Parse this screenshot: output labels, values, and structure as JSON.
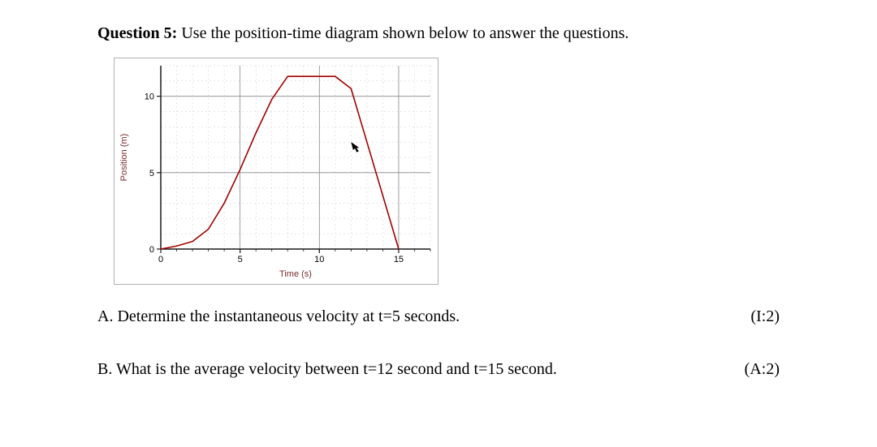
{
  "question": {
    "label": "Question 5:",
    "prompt": "Use the position-time diagram shown below to answer the questions."
  },
  "parts": [
    {
      "id": "A",
      "text": "A. Determine the instantaneous velocity at t=5 seconds.",
      "marks": "(I:2)"
    },
    {
      "id": "B",
      "text": "B. What is the average velocity between t=12 second and t=15 second.",
      "marks": "(A:2)"
    }
  ],
  "chart_data": {
    "type": "line",
    "title": "",
    "xlabel": "Time (s)",
    "ylabel": "Position (m)",
    "xlim": [
      0,
      17
    ],
    "ylim": [
      0,
      12
    ],
    "xticks": [
      0,
      5,
      10,
      15
    ],
    "xtick_labels": [
      "0",
      "5",
      "10",
      "15"
    ],
    "yticks": [
      0,
      5,
      10
    ],
    "ytick_labels": [
      "0",
      "5",
      "10"
    ],
    "x": [
      0,
      1,
      2,
      3,
      4,
      5,
      6,
      7,
      8,
      11,
      12,
      13,
      14,
      15
    ],
    "y": [
      0,
      0.2,
      0.5,
      1.3,
      3.0,
      5.2,
      7.6,
      9.8,
      11.3,
      11.3,
      10.5,
      7.0,
      3.5,
      0
    ],
    "cursor_point": {
      "x": 12,
      "y": 7
    },
    "grid": {
      "major": true,
      "minor": true
    },
    "colors": {
      "curve": "#a00000",
      "axis": "#1a1a1a",
      "minor_grid": "#cccccc",
      "major_grid": "#888888",
      "axis_titles": "#7a2b2b",
      "border": "#b0b0b0"
    }
  }
}
